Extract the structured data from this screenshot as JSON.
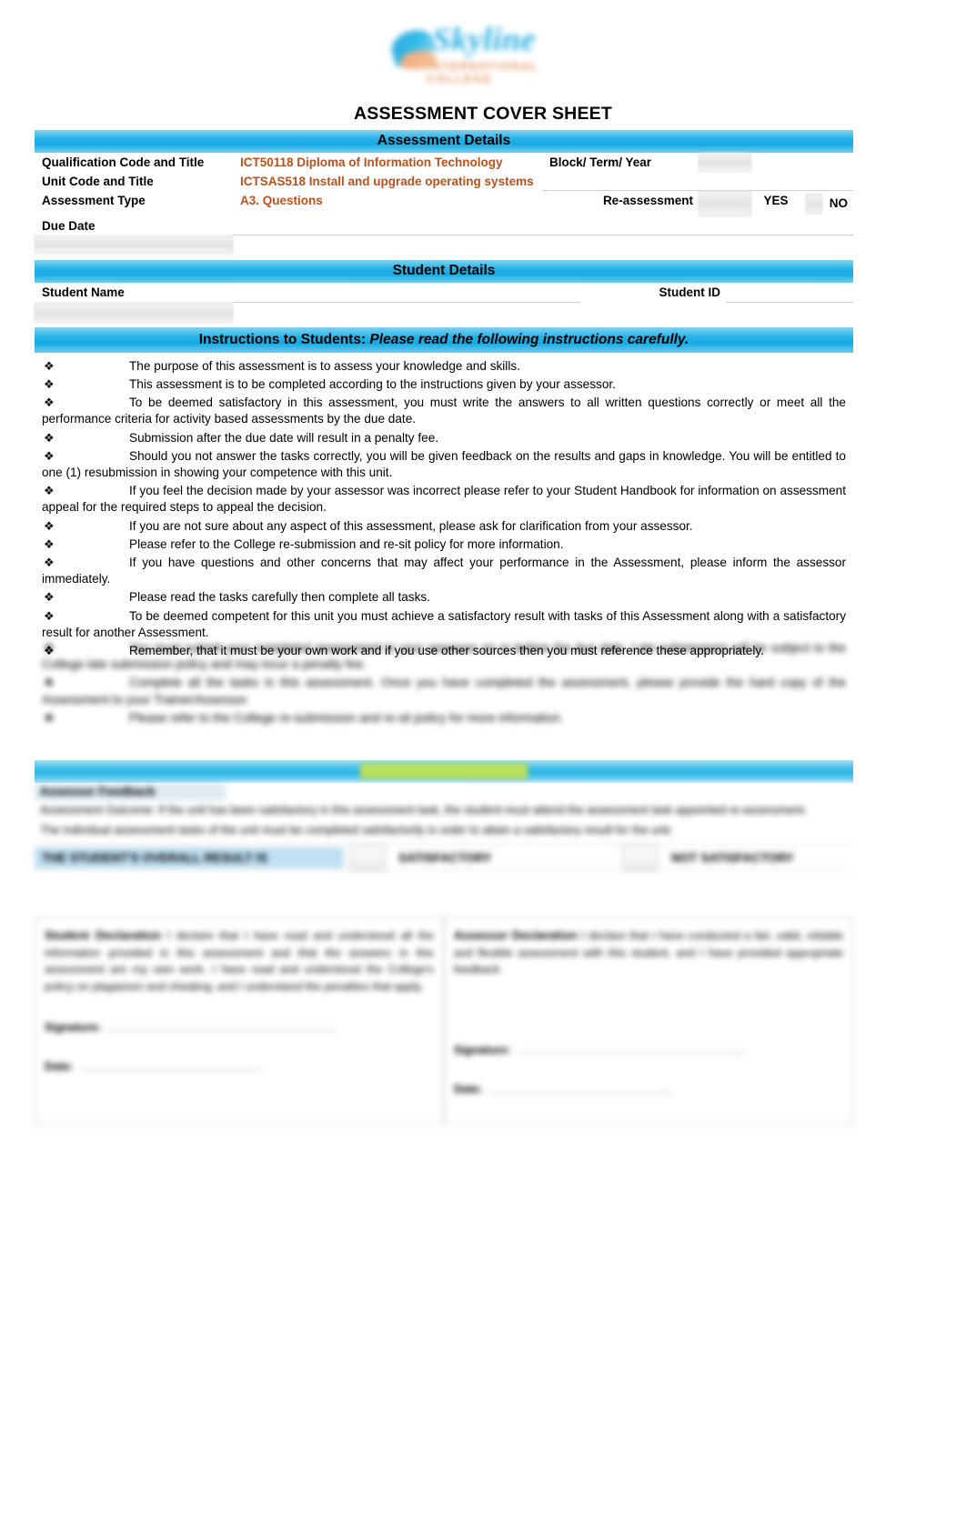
{
  "logo": {
    "wordmark": "Skyline",
    "tagline": "INTERNATIONAL COLLEGE",
    "brand_blue": "#22ade0",
    "brand_orange": "#e08a4e"
  },
  "document": {
    "title": "ASSESSMENT COVER SHEET"
  },
  "assessment_details": {
    "band_title": "Assessment Details",
    "rows": [
      {
        "label": "Qualification Code and Title",
        "value": "ICT50118 Diploma of Information Technology"
      },
      {
        "label": "Unit Code and Title",
        "value": "ICTSAS518 Install and upgrade operating systems"
      },
      {
        "label": "Assessment Type",
        "value": "A3. Questions"
      },
      {
        "label": "Due Date",
        "value": ""
      }
    ],
    "block_term_year_label": "Block/ Term/ Year",
    "block_term_year_value": "",
    "reassessment_label": "Re-assessment",
    "reassessment_yes": "YES",
    "reassessment_no": "NO",
    "value_color": "#c0501a"
  },
  "student_details": {
    "band_title": "Student Details",
    "student_name_label": "Student Name",
    "student_name_value": "",
    "student_id_label": "Student ID",
    "student_id_value": ""
  },
  "instructions": {
    "band_title_bold": "Instructions to Students:",
    "band_title_italic": " Please read the following instructions carefully.",
    "bullet_glyph": "❖",
    "items": [
      "The purpose of this assessment is to assess your knowledge and skills.",
      "This assessment is to be completed according to the instructions given by your assessor.",
      "To be deemed satisfactory in this assessment, you must write the answers to all written questions correctly or meet all the performance criteria for activity based assessments by the due date.",
      "Submission after the due date will result in a penalty fee.",
      "Should you not answer the tasks correctly, you will be given feedback on the results and gaps in knowledge. You will be entitled to one (1) resubmission in showing your competence with this unit.",
      "If you feel the decision made by your assessor was incorrect please refer to your Student Handbook for information on assessment appeal for the required steps to appeal the decision.",
      "If you are not sure about any aspect of this assessment, please ask for clarification from your assessor.",
      "Please refer to the College re-submission and re-sit policy for more information.",
      "If you have questions and other concerns that may affect your performance in the Assessment, please inform the assessor immediately.",
      "Please read the tasks carefully then complete all tasks.",
      "To be deemed competent for this unit you must achieve a satisfactory result with tasks of this Assessment along with a satisfactory result for another Assessment.",
      "Remember, that it must be your own work and if you use other sources then you must reference these appropriately."
    ],
    "redacted_items": [
      "You must submit your completed assessment to your assessor on or before the due date. Late submissions will be subject to the College late submission policy and may incur a penalty fee.",
      "Complete all the tasks in this assessment. Once you have completed the assessment, please provide the hard copy of the Assessment to your Trainer/Assessor.",
      "Please refer to the College re-submission and re-sit policy for more information."
    ]
  },
  "assessment_result": {
    "band_title_redacted": "ASSESSMENT RESULT",
    "heading_redacted": "Assessor Feedback",
    "paragraphs_redacted": [
      "Assessment Outcome: If the unit has been satisfactory in this assessment task, the student must attend the assessment task appointed re-assessment.",
      "The individual assessment tasks of the unit must be completed satisfactorily in order to attain a satisfactory result for the unit."
    ],
    "row_label_redacted": "THE STUDENT'S OVERALL RESULT IS",
    "option_satisfactory": "SATISFACTORY",
    "option_not_satisfactory": "NOT SATISFACTORY"
  },
  "declarations": {
    "student": {
      "heading": "Student Declaration",
      "body": "I declare that I have read and understood all the information provided in this assessment and that the answers in this assessment are my own work. I have read and understood the College's policy on plagiarism and cheating, and I understand the penalties that apply."
    },
    "assessor": {
      "heading": "Assessor Declaration",
      "body": "I declare that I have conducted a fair, valid, reliable and flexible assessment with this student, and I have provided appropriate feedback."
    },
    "signature_label": "Signature:",
    "date_label": "Date:"
  }
}
